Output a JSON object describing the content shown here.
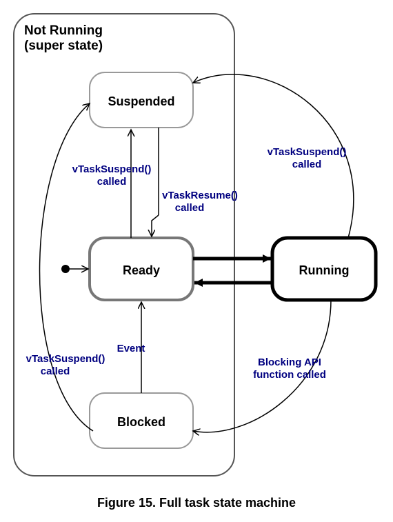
{
  "caption": "Figure 15.  Full task state machine",
  "superstate": {
    "title_line1": "Not Running",
    "title_line2": "(super state)"
  },
  "states": {
    "suspended": "Suspended",
    "ready": "Ready",
    "running": "Running",
    "blocked": "Blocked"
  },
  "edges": {
    "suspend_ready_l1": "vTaskSuspend()",
    "suspend_ready_l2": "called",
    "resume_l1": "vTaskResume()",
    "resume_l2": "called",
    "suspend_running_l1": "vTaskSuspend()",
    "suspend_running_l2": "called",
    "suspend_blocked_l1": "vTaskSuspend()",
    "suspend_blocked_l2": "called",
    "event": "Event",
    "blocking_l1": "Blocking API",
    "blocking_l2": "function called"
  },
  "chart_data": {
    "type": "state_machine",
    "title": "Full task state machine",
    "superstate": {
      "name": "Not Running",
      "contains": [
        "Suspended",
        "Ready",
        "Blocked"
      ]
    },
    "states": [
      "Suspended",
      "Ready",
      "Running",
      "Blocked"
    ],
    "initial_state": "Ready",
    "transitions": [
      {
        "from": "Ready",
        "to": "Suspended",
        "label": "vTaskSuspend() called"
      },
      {
        "from": "Suspended",
        "to": "Ready",
        "label": "vTaskResume() called"
      },
      {
        "from": "Ready",
        "to": "Running",
        "label": ""
      },
      {
        "from": "Running",
        "to": "Ready",
        "label": ""
      },
      {
        "from": "Running",
        "to": "Suspended",
        "label": "vTaskSuspend() called"
      },
      {
        "from": "Running",
        "to": "Blocked",
        "label": "Blocking API function called"
      },
      {
        "from": "Blocked",
        "to": "Ready",
        "label": "Event"
      },
      {
        "from": "Blocked",
        "to": "Suspended",
        "label": "vTaskSuspend() called"
      }
    ]
  }
}
